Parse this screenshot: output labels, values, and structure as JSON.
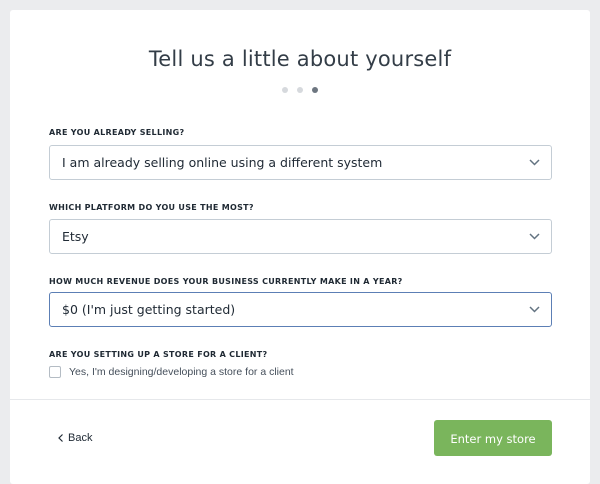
{
  "header": {
    "title": "Tell us a little about yourself"
  },
  "stepper": {
    "total": 3,
    "current": 3
  },
  "questions": [
    {
      "label": "ARE YOU ALREADY SELLING?",
      "value": "I am already selling online using a different system"
    },
    {
      "label": "WHICH PLATFORM DO YOU USE THE MOST?",
      "value": "Etsy"
    },
    {
      "label": "HOW MUCH REVENUE DOES YOUR BUSINESS CURRENTLY MAKE IN A YEAR?",
      "value": "$0 (I'm just getting started)"
    }
  ],
  "client_question": {
    "label": "ARE YOU SETTING UP A STORE FOR A CLIENT?",
    "checkbox_label": "Yes, I'm designing/developing a store for a client",
    "checked": false
  },
  "footer": {
    "back_label": "Back",
    "submit_label": "Enter my store"
  },
  "colors": {
    "accent": "#7ab55c",
    "focus_border": "#5c7fb5"
  }
}
